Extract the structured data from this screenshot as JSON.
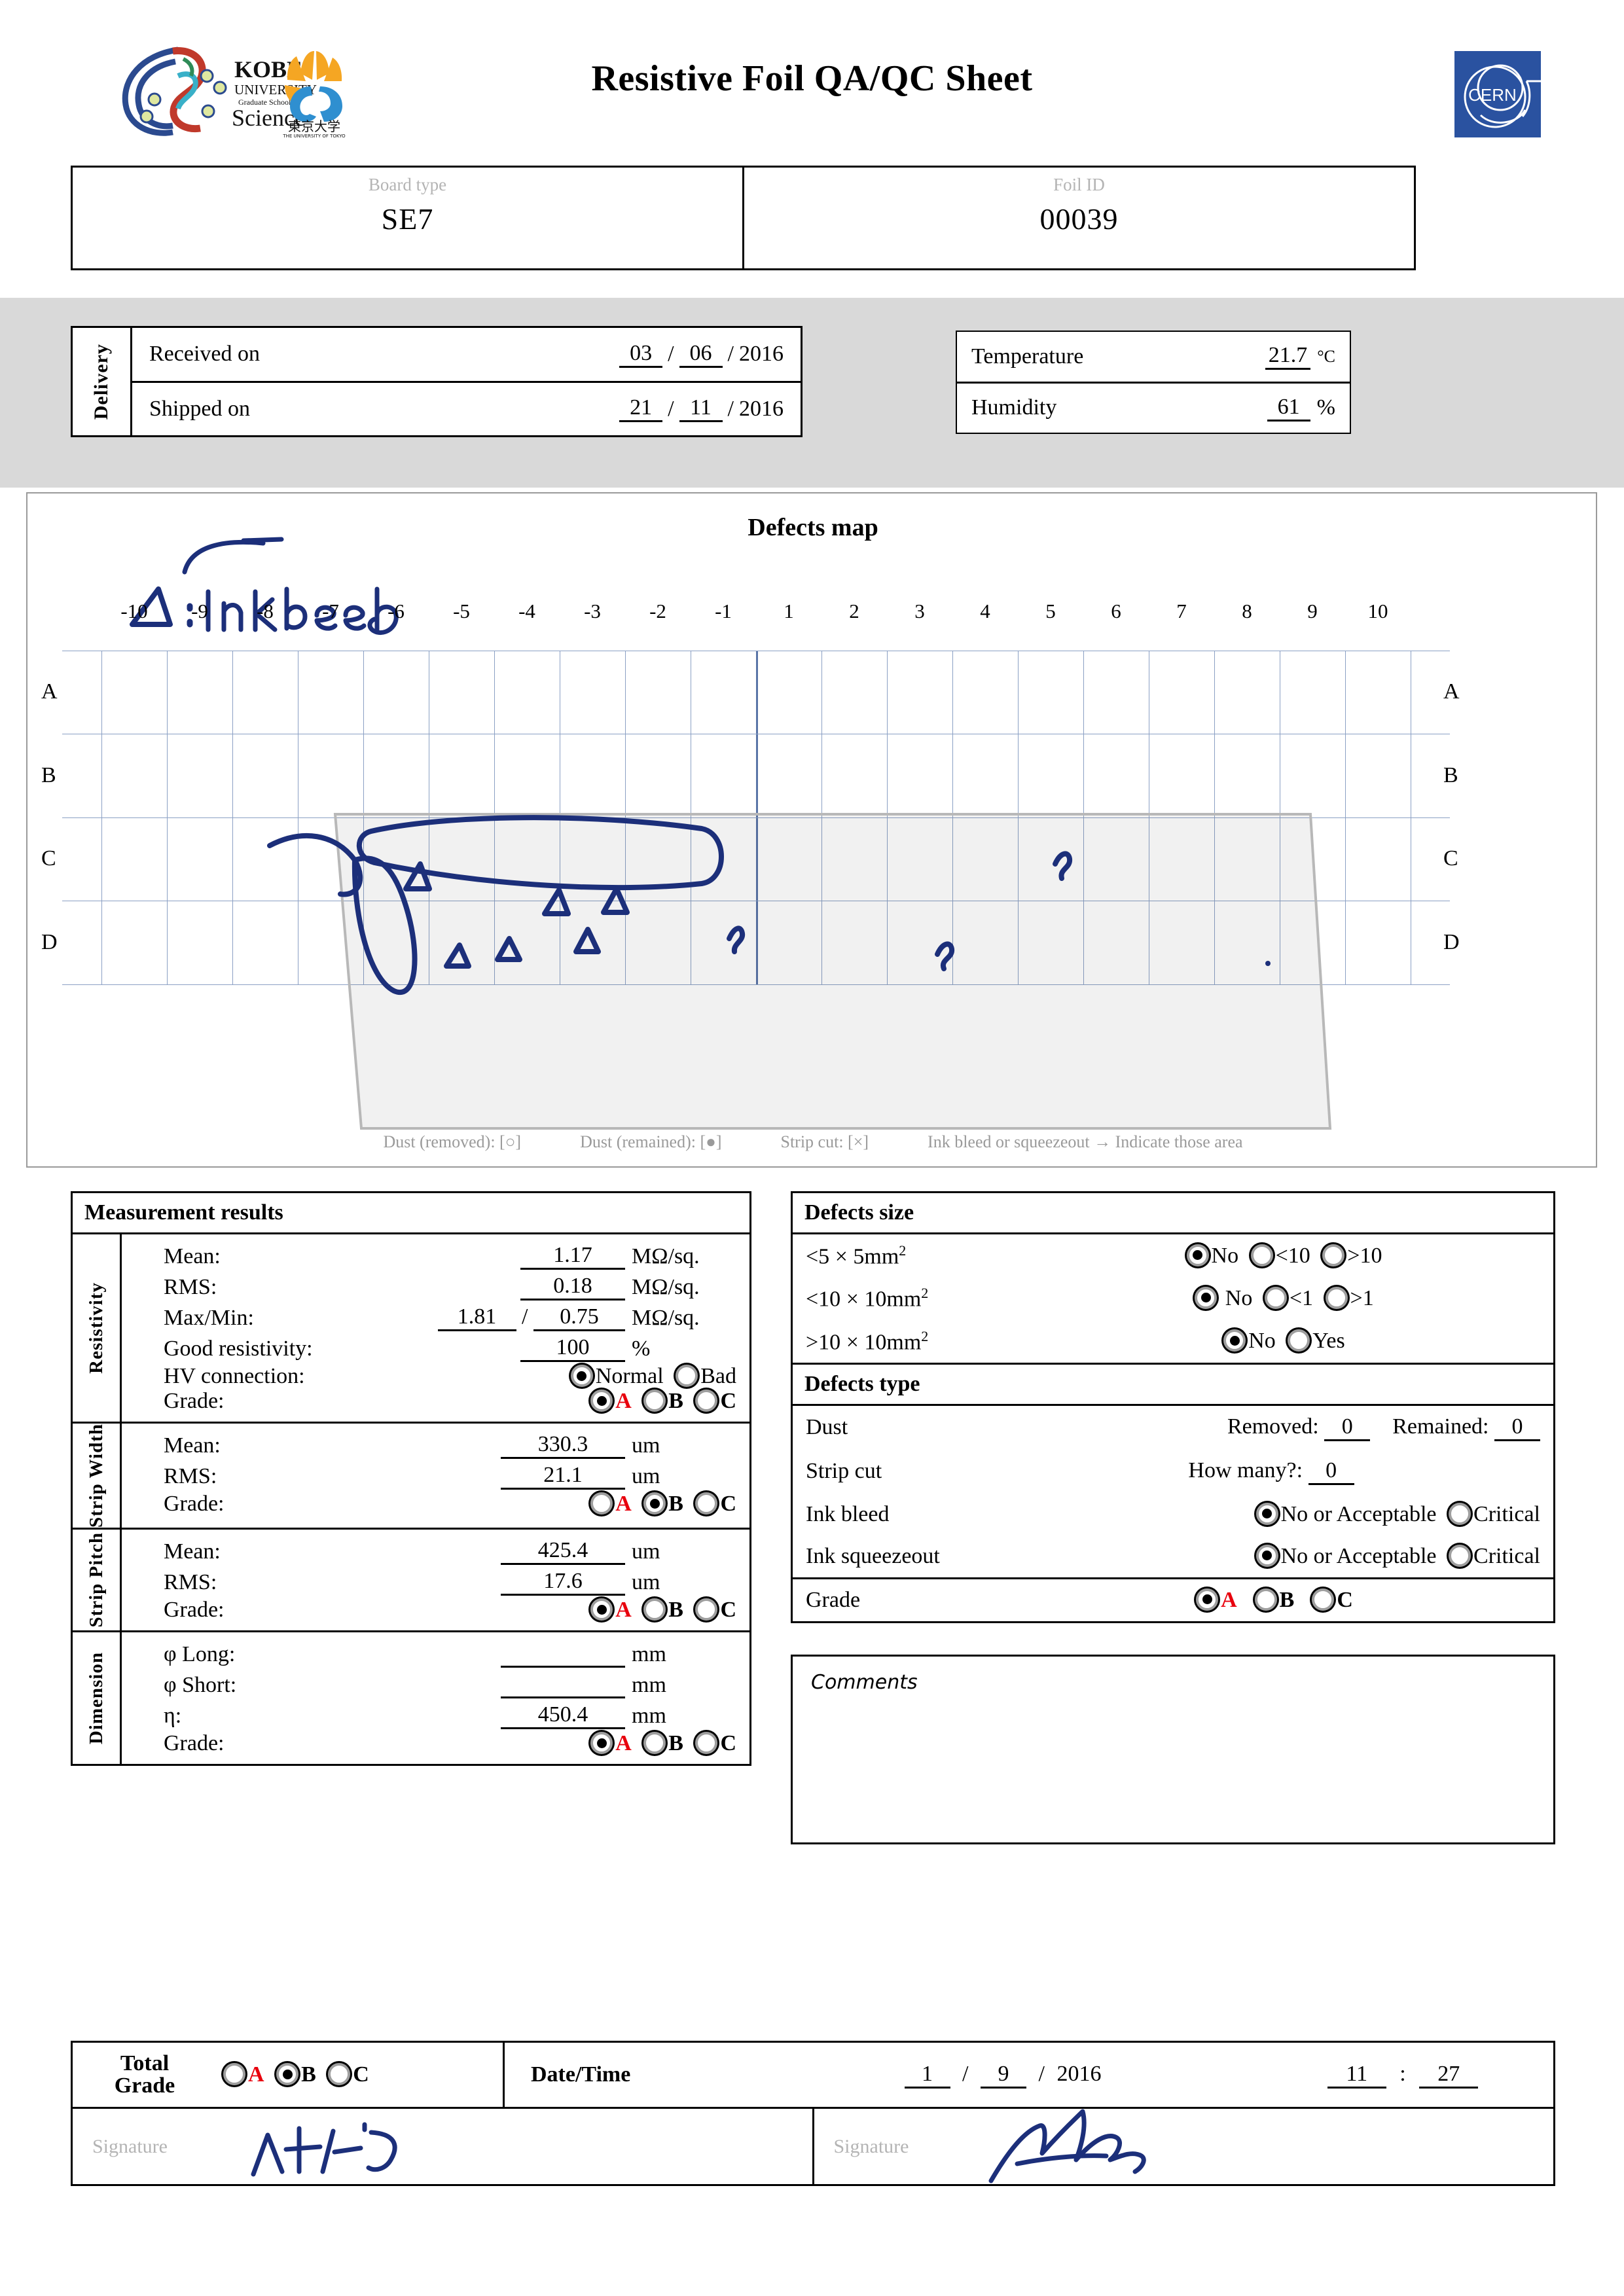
{
  "header": {
    "title": "Resistive Foil QA/QC Sheet",
    "logo_kobe": "kobe-university-logo",
    "logo_tokyo": "university-of-tokyo-logo",
    "logo_cern": "CERN"
  },
  "identity": {
    "board_type_label": "Board type",
    "board_type_value": "SE7",
    "foil_id_label": "Foil ID",
    "foil_id_value": "00039"
  },
  "delivery": {
    "tab_label": "Delivery",
    "received_label": "Received on",
    "received_day": "03",
    "received_month": "06",
    "received_year": "2016",
    "shipped_label": "Shipped on",
    "shipped_day": "21",
    "shipped_month": "11",
    "shipped_year": "2016",
    "slash": "/"
  },
  "environment": {
    "temperature_label": "Temperature",
    "temperature_value": "21.7",
    "temperature_unit": "°C",
    "humidity_label": "Humidity",
    "humidity_value": "61",
    "humidity_unit": "%"
  },
  "defects_map": {
    "title": "Defects map",
    "columns": [
      "-10",
      "-9",
      "-8",
      "-7",
      "-6",
      "-5",
      "-4",
      "-3",
      "-2",
      "-1",
      "1",
      "2",
      "3",
      "4",
      "5",
      "6",
      "7",
      "8",
      "9",
      "10"
    ],
    "rows": [
      "A",
      "B",
      "C",
      "D"
    ],
    "handwriting_note": "△ : ink bleed",
    "handwriting_label_left": "ink bleed",
    "legend": [
      "Dust (removed): [○]",
      "Dust (remained): [●]",
      "Strip cut: [×]",
      "Ink bleed or squeezeout → Indicate those area"
    ]
  },
  "measurement": {
    "heading": "Measurement results",
    "resistivity": {
      "tab": "Resistivity",
      "mean_label": "Mean:",
      "mean_value": "1.17",
      "mean_unit": "MΩ/sq.",
      "rms_label": "RMS:",
      "rms_value": "0.18",
      "rms_unit": "MΩ/sq.",
      "maxmin_label": "Max/Min:",
      "max_value": "1.81",
      "min_value": "0.75",
      "maxmin_unit": "MΩ/sq.",
      "good_label": "Good resistivity:",
      "good_value": "100",
      "good_unit": "%",
      "hv_label": "HV connection:",
      "hv_options": [
        "Normal",
        "Bad"
      ],
      "hv_selected": "Normal",
      "grade_label": "Grade:",
      "grade_options": [
        "A",
        "B",
        "C"
      ],
      "grade_selected": "A"
    },
    "strip_width": {
      "tab": "Strip Width",
      "mean_label": "Mean:",
      "mean_value": "330.3",
      "mean_unit": "um",
      "rms_label": "RMS:",
      "rms_value": "21.1",
      "rms_unit": "um",
      "grade_label": "Grade:",
      "grade_options": [
        "A",
        "B",
        "C"
      ],
      "grade_selected": "B"
    },
    "strip_pitch": {
      "tab": "Strip Pitch",
      "mean_label": "Mean:",
      "mean_value": "425.4",
      "mean_unit": "um",
      "rms_label": "RMS:",
      "rms_value": "17.6",
      "rms_unit": "um",
      "grade_label": "Grade:",
      "grade_options": [
        "A",
        "B",
        "C"
      ],
      "grade_selected": "A"
    },
    "dimension": {
      "tab": "Dimension",
      "long_label": "φ Long:",
      "long_value": "",
      "long_unit": "mm",
      "short_label": "φ Short:",
      "short_value": "",
      "short_unit": "mm",
      "eta_label": "η:",
      "eta_value": "450.4",
      "eta_unit": "mm",
      "grade_label": "Grade:",
      "grade_options": [
        "A",
        "B",
        "C"
      ],
      "grade_selected": "A"
    }
  },
  "defects_size": {
    "heading": "Defects size",
    "rows": [
      {
        "label_prefix": "<5",
        "times": "×",
        "label_suffix": "5mm",
        "sup": "2",
        "options": [
          "No",
          "<10",
          ">10"
        ],
        "selected": "No"
      },
      {
        "label_prefix": "<10",
        "times": "×",
        "label_suffix": "10mm",
        "sup": "2",
        "options": [
          " No",
          "<1",
          ">1"
        ],
        "selected": " No"
      },
      {
        "label_prefix": ">10",
        "times": "×",
        "label_suffix": "10mm",
        "sup": "2",
        "options": [
          "No",
          "Yes"
        ],
        "selected": "No"
      }
    ]
  },
  "defects_type": {
    "heading": "Defects type",
    "dust_label": "Dust",
    "dust_removed_label": "Removed:",
    "dust_removed_value": "0",
    "dust_remained_label": "Remained:",
    "dust_remained_value": "0",
    "strip_cut_label": "Strip cut",
    "strip_cut_question": "How many?:",
    "strip_cut_value": "0",
    "ink_bleed_label": "Ink bleed",
    "ink_bleed_options": [
      "No or Acceptable",
      "Critical"
    ],
    "ink_bleed_selected": "No or Acceptable",
    "ink_squeezeout_label": "Ink squeezeout",
    "ink_squeezeout_options": [
      "No or Acceptable",
      "Critical"
    ],
    "ink_squeezeout_selected": "No or Acceptable",
    "grade_label": "Grade",
    "grade_options": [
      "A",
      "B",
      "C"
    ],
    "grade_selected": "A"
  },
  "comments": {
    "heading": "Comments",
    "body": ""
  },
  "footer": {
    "total_grade_label_line1": "Total",
    "total_grade_label_line2": "Grade",
    "total_grade_options": [
      "A",
      "B",
      "C"
    ],
    "total_grade_selected": "B",
    "datetime_label": "Date/Time",
    "date_day": "1",
    "date_month": "9",
    "date_year": "2016",
    "time_hour": "11",
    "time_minute": "27",
    "slash": "/",
    "colon": ":",
    "signature_label_left": "Signature",
    "signature_label_right": "Signature"
  },
  "colors": {
    "grade_a": "#e8000d",
    "grid_line": "#8ba0c4",
    "band": "#d9d9d9",
    "ink": "#1c2f7a",
    "cern_blue": "#2a52a0",
    "muted": "#b4b4b4"
  }
}
